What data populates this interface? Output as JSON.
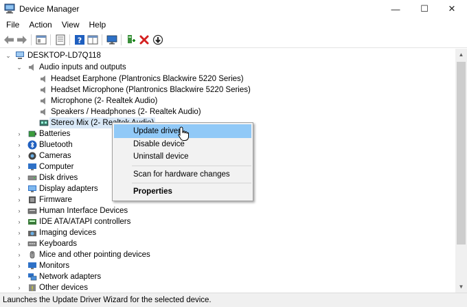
{
  "window": {
    "title": "Device Manager",
    "minimize_glyph": "—",
    "maximize_glyph": "☐",
    "close_glyph": "✕"
  },
  "menu": [
    "File",
    "Action",
    "View",
    "Help"
  ],
  "toolbar": {
    "icons": [
      "back-arrow-icon",
      "forward-arrow-icon",
      "console-tree-icon",
      "properties-icon",
      "help-icon",
      "view-icon",
      "monitor-icon",
      "add-driver-icon",
      "uninstall-x-icon",
      "update-down-icon"
    ]
  },
  "tree": {
    "root": "DESKTOP-LD7Q118",
    "expanded_category": "Audio inputs and outputs",
    "audio_children": [
      "Headset Earphone (Plantronics Blackwire 5220 Series)",
      "Headset Microphone (Plantronics Blackwire 5220 Series)",
      "Microphone (2- Realtek Audio)",
      "Speakers / Headphones (2- Realtek Audio)",
      "Stereo Mix (2- Realtek Audio)"
    ],
    "categories": [
      "Batteries",
      "Bluetooth",
      "Cameras",
      "Computer",
      "Disk drives",
      "Display adapters",
      "Firmware",
      "Human Interface Devices",
      "IDE ATA/ATAPI controllers",
      "Imaging devices",
      "Keyboards",
      "Mice and other pointing devices",
      "Monitors",
      "Network adapters",
      "Other devices"
    ]
  },
  "context_menu": {
    "items": [
      "Update driver",
      "Disable device",
      "Uninstall device",
      "Scan for hardware changes",
      "Properties"
    ],
    "highlighted": "Update driver"
  },
  "status": "Launches the Update Driver Wizard for the selected device.",
  "colors": {
    "highlight": "#91c9f7",
    "selection": "#d9e8f7",
    "close_red": "#d42020",
    "help_blue": "#1f5fbf"
  }
}
